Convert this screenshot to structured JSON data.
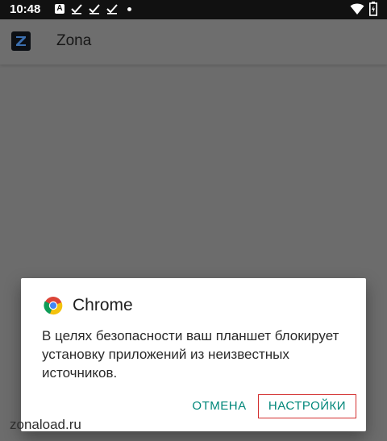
{
  "status_bar": {
    "time": "10:48",
    "notification_icons": [
      "a-icon",
      "check-icon",
      "check-icon",
      "check-icon",
      "dot-icon"
    ],
    "notif_letter": "A",
    "right_icons": [
      "wifi-icon",
      "battery-icon"
    ]
  },
  "app_bar": {
    "logo_icon": "zona-logo-icon",
    "title": "Zona"
  },
  "dialog": {
    "icon": "chrome-icon",
    "title": "Chrome",
    "message": "В целях безопасности ваш планшет блокирует установку приложений из неизвестных источников.",
    "cancel_label": "ОТМЕНА",
    "settings_label": "НАСТРОЙКИ"
  },
  "watermark": "zonaload.ru",
  "colors": {
    "scrim": "#6c6c6c",
    "status_bar": "#111111",
    "accent": "#00877a",
    "highlight": "#d32f2f"
  }
}
